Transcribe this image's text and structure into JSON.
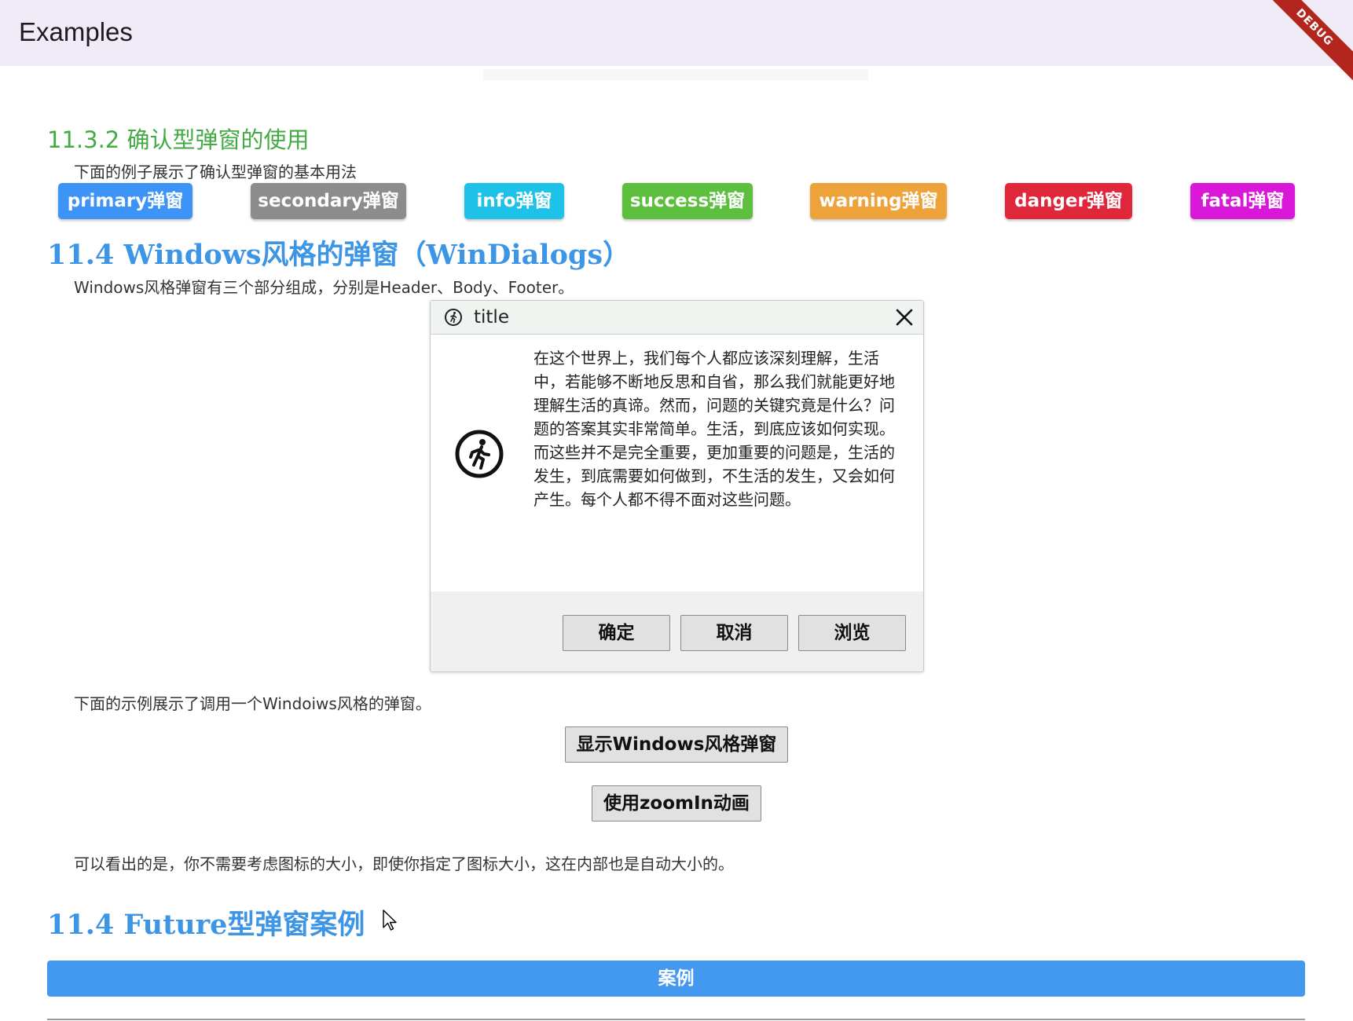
{
  "appbar": {
    "title": "Examples",
    "debug_label": "DEBUG"
  },
  "confirm_section": {
    "heading": "11.3.2 确认型弹窗的使用",
    "description": "下面的例子展示了确认型弹窗的基本用法",
    "buttons": [
      {
        "label": "primary弹窗",
        "color": "#3d94f6"
      },
      {
        "label": "secondary弹窗",
        "color": "#8c8c8c"
      },
      {
        "label": "info弹窗",
        "color": "#1ec2e8"
      },
      {
        "label": "success弹窗",
        "color": "#5cbf3d"
      },
      {
        "label": "warning弹窗",
        "color": "#eda23a"
      },
      {
        "label": "danger弹窗",
        "color": "#e0263a"
      },
      {
        "label": "fatal弹窗",
        "color": "#d917d9"
      }
    ]
  },
  "windows_section": {
    "heading": "11.4 Windows风格的弹窗（WinDialogs）",
    "description": "Windows风格弹窗有三个部分组成，分别是Header、Body、Footer。",
    "dialog": {
      "title": "title",
      "header_icon": "running-man-icon",
      "body_icon": "running-man-icon",
      "body_text": "在这个世界上，我们每个人都应该深刻理解，生活中，若能够不断地反思和自省，那么我们就能更好地理解生活的真谛。然而，问题的关键究竟是什么？问题的答案其实非常简单。生活，到底应该如何实现。而这些并不是完全重要，更加重要的问题是，生活的发生，到底需要如何做到，不生活的发生，又会如何产生。每个人都不得不面对这些问题。",
      "ok_label": "确定",
      "cancel_label": "取消",
      "browse_label": "浏览"
    },
    "example_text": "下面的示例展示了调用一个Windoiws风格的弹窗。",
    "show_button_label": "显示Windows风格弹窗",
    "zoom_button_label": "使用zoomIn动画",
    "note_text": "可以看出的是，你不需要考虑图标的大小，即使你指定了图标大小，这在内部也是自动大小的。"
  },
  "future_section": {
    "heading": "11.4 Future型弹窗案例",
    "case_button_label": "案例"
  }
}
